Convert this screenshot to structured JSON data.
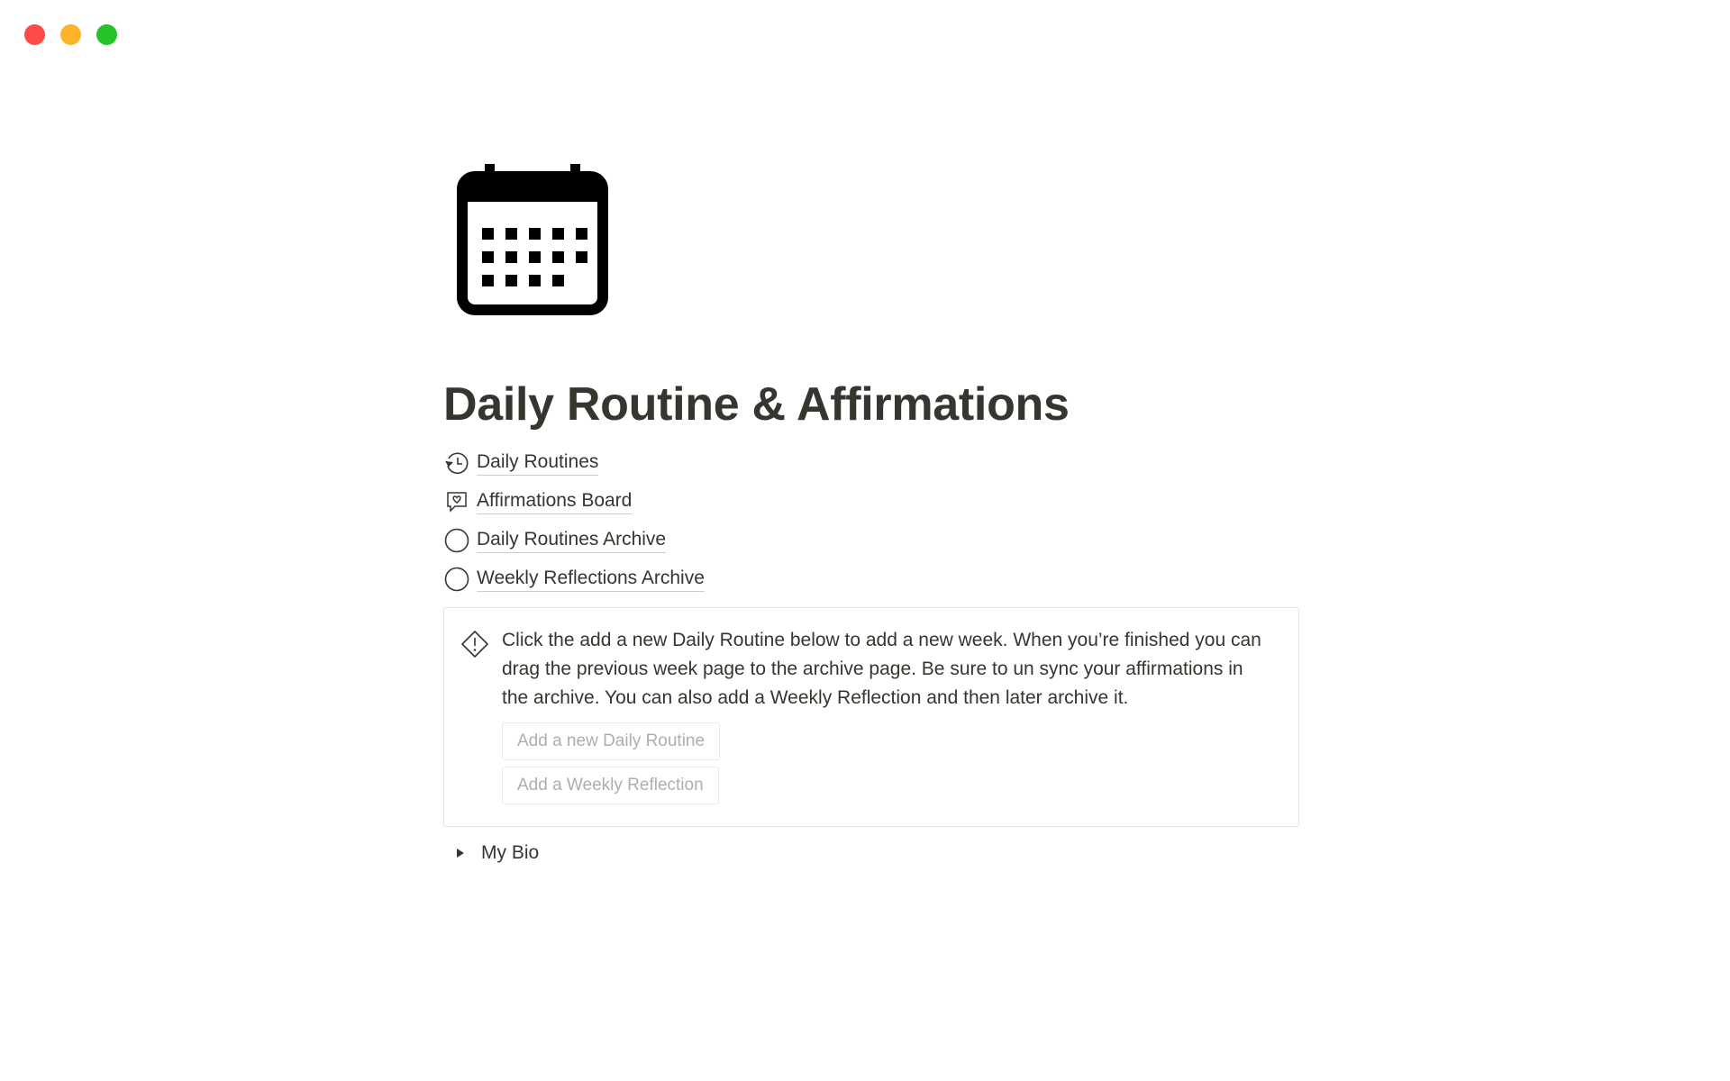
{
  "window": {
    "controls": {
      "close_color": "#fe4a49",
      "minimize_color": "#feb429",
      "maximize_color": "#24c428"
    }
  },
  "page": {
    "icon": "calendar-icon",
    "title": "Daily Routine & Affirmations",
    "links": [
      {
        "label": "Daily Routines",
        "icon": "history-clock-icon"
      },
      {
        "label": "Affirmations Board",
        "icon": "heart-speech-bubble-icon"
      },
      {
        "label": "Daily Routines Archive",
        "icon": "circle-icon"
      },
      {
        "label": "Weekly Reflections Archive",
        "icon": "circle-icon"
      }
    ],
    "callout": {
      "icon": "warning-diamond-icon",
      "text": "Click the add a new Daily Routine below to add a new week. When you’re finished you can drag the previous week page to the archive page. Be sure to un sync your affirmations in the archive. You can also add a Weekly Reflection and then later archive it.",
      "buttons": [
        "Add a new Daily Routine",
        "Add a Weekly Reflection"
      ]
    },
    "toggle": {
      "label": "My Bio",
      "icon": "triangle-right-icon"
    }
  }
}
